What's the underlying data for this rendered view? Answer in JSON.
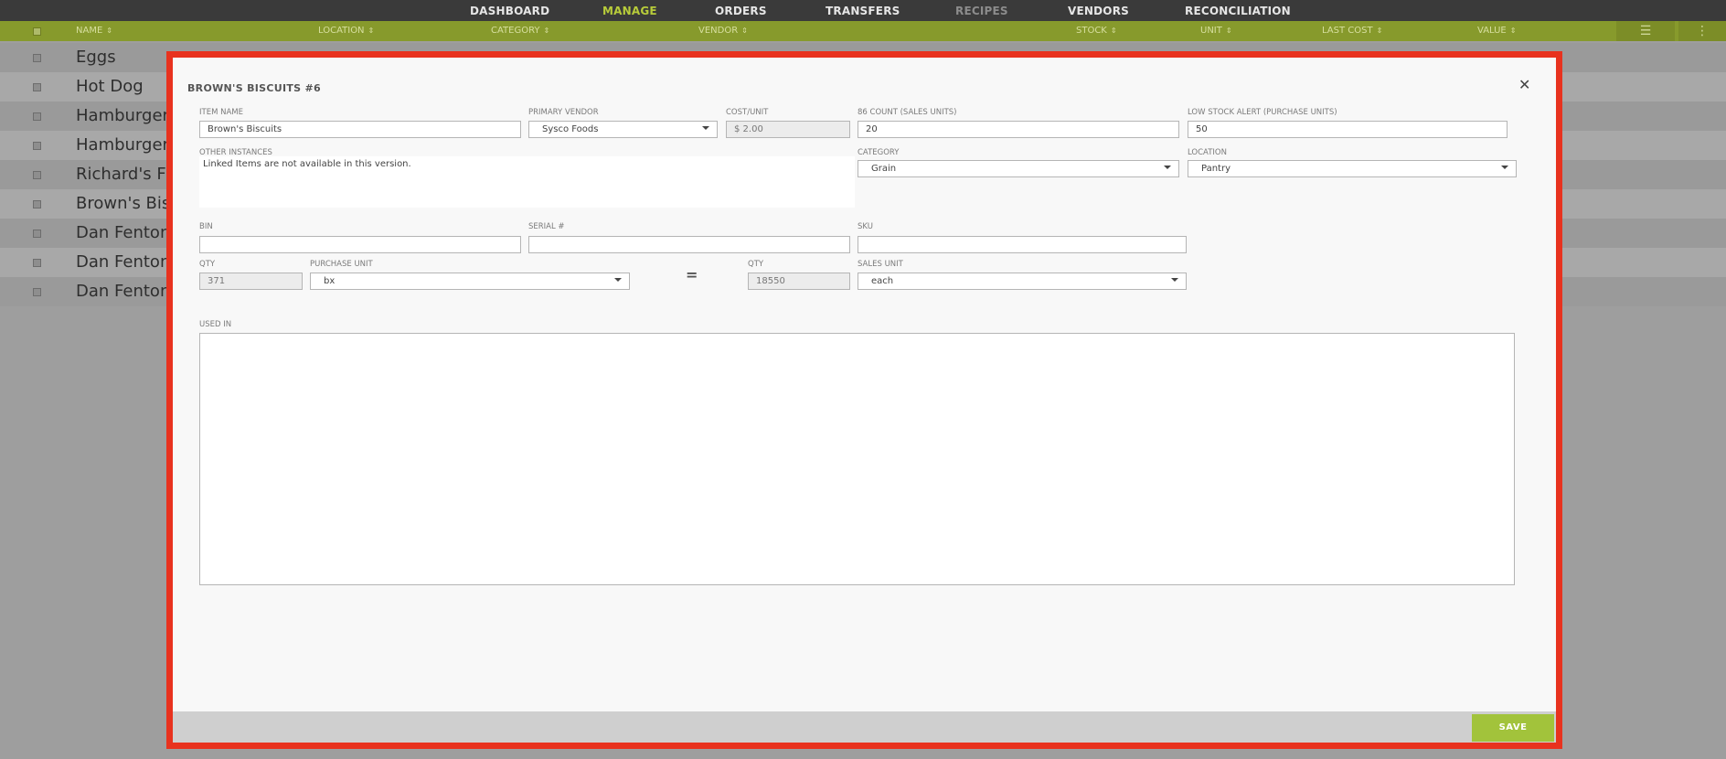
{
  "nav": {
    "items": [
      "DASHBOARD",
      "MANAGE",
      "ORDERS",
      "TRANSFERS",
      "RECIPES",
      "VENDORS",
      "RECONCILIATION"
    ],
    "active": "MANAGE"
  },
  "columns": {
    "name": "NAME",
    "location": "LOCATION",
    "category": "CATEGORY",
    "vendor": "VENDOR",
    "stock": "STOCK",
    "unit": "UNIT",
    "last_cost": "LAST COST",
    "value": "VALUE"
  },
  "rows": [
    "Eggs",
    "Hot Dog",
    "Hamburger",
    "Hamburger",
    "Richard's Fin",
    "Brown's Bisc",
    "Dan Fenton'",
    "Dan Fenton'",
    "Dan Fenton'"
  ],
  "modal": {
    "title": "BROWN'S BISCUITS #6",
    "item_name_label": "ITEM NAME",
    "item_name": "Brown's Biscuits",
    "primary_vendor_label": "PRIMARY VENDOR",
    "primary_vendor": "Sysco Foods",
    "cost_unit_label": "COST/UNIT",
    "cost_unit": "$ 2.00",
    "count86_label": "86 COUNT (SALES UNITS)",
    "count86": "20",
    "low_stock_label": "LOW STOCK ALERT (PURCHASE UNITS)",
    "low_stock": "50",
    "other_instances_label": "OTHER INSTANCES",
    "other_instances_note": "Linked Items are not available in this version.",
    "category_label": "CATEGORY",
    "category": "Grain",
    "location_label": "LOCATION",
    "location": "Pantry",
    "bin_label": "BIN",
    "bin": "",
    "serial_label": "SERIAL #",
    "serial": "",
    "sku_label": "SKU",
    "sku": "",
    "qty_label": "QTY",
    "qty": "371",
    "purchase_unit_label": "PURCHASE UNIT",
    "purchase_unit": "bx",
    "equals": "=",
    "qty2_label": "QTY",
    "qty2": "18550",
    "sales_unit_label": "SALES UNIT",
    "sales_unit": "each",
    "used_in_label": "USED IN",
    "save_label": "SAVE"
  },
  "colors": {
    "accent": "#a2c33b",
    "header_bar": "#879a2c",
    "nav_bg": "#3a3a3a",
    "highlight_border": "#e8321e"
  }
}
